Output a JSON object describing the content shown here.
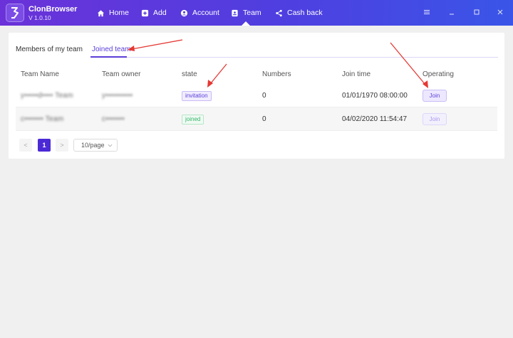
{
  "app": {
    "name": "ClonBrowser",
    "version": "V 1.0.10"
  },
  "nav": {
    "home": "Home",
    "add": "Add",
    "account": "Account",
    "team": "Team",
    "cashback": "Cash back"
  },
  "tabs": {
    "members": "Members of my team",
    "joined": "Joined team"
  },
  "table": {
    "headers": [
      "Team Name",
      "Team owner",
      "state",
      "Numbers",
      "Join time",
      "Operating"
    ],
    "rows": [
      {
        "team_name": "y•••••d•••• Team",
        "owner": "y••••••••••",
        "state": "invitation",
        "numbers": "0",
        "join_time": "01/01/1970 08:00:00",
        "action": "Join"
      },
      {
        "team_name": "c••••••• Team",
        "owner": "c•••••••",
        "state": "joined",
        "numbers": "0",
        "join_time": "04/02/2020 11:54:47",
        "action": "Join"
      }
    ]
  },
  "pagination": {
    "prev": "<",
    "current": "1",
    "next": ">",
    "page_size": "10/page"
  },
  "colors": {
    "accent": "#5b3fd8",
    "topbar_start": "#6a32d8",
    "topbar_end": "#3a55e8",
    "joined": "#36b36a",
    "arrow": "#e53935"
  }
}
